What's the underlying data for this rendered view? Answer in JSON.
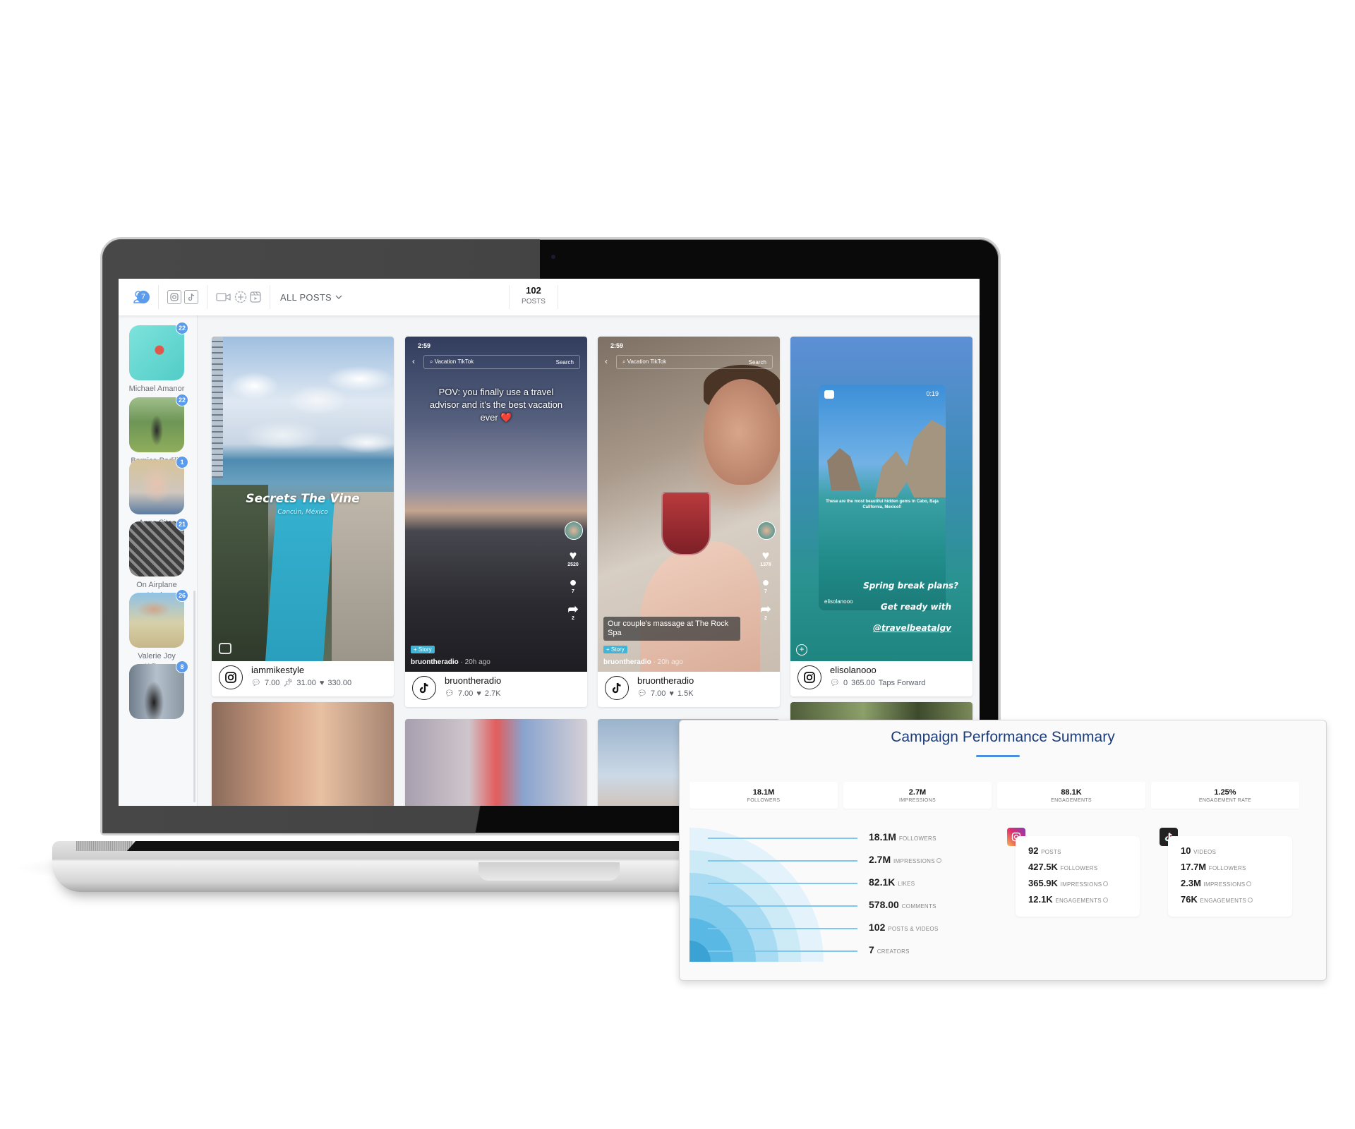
{
  "app": {
    "header": {
      "creators_count": "7",
      "filter_label": "ALL POSTS",
      "posts_count": "102",
      "posts_label": "POSTS",
      "icons": [
        "creators-icon",
        "instagram-filter-icon",
        "tiktok-filter-icon",
        "video-icon",
        "add-icon",
        "reel-icon",
        "chevron-down-icon"
      ]
    },
    "sidebar": {
      "creators": [
        {
          "name": "Michael Amanor",
          "count": "22"
        },
        {
          "name": "Bernice Padilla",
          "count": "22"
        },
        {
          "name": "Anna Sitar",
          "count": "1"
        },
        {
          "name": "On Airplane Mode",
          "count": "21"
        },
        {
          "name": "Valerie Joy Wilson",
          "count": "26"
        },
        {
          "name": "",
          "count": "8"
        }
      ]
    },
    "posts": [
      {
        "platform": "instagram",
        "handle": "iammikestyle",
        "overlay_title": "Secrets The Vine",
        "overlay_subtitle": "Cancún, México",
        "stats": {
          "comments": "7.00",
          "saves": "31.00",
          "likes": "330.00"
        }
      },
      {
        "platform": "tiktok",
        "handle": "bruontheradio",
        "status_time": "2:59",
        "search_text": "Vacation TikTok",
        "search_button": "Search",
        "caption": "POV: you finally use a travel advisor and it's the best vacation ever ❤️",
        "side": {
          "likes": "2520",
          "comments": "7",
          "shares": "2"
        },
        "story_chip": "+ Story",
        "author": "bruontheradio",
        "ago": "· 20h ago",
        "stats": {
          "comments": "7.00",
          "likes": "2.7K"
        }
      },
      {
        "platform": "tiktok",
        "handle": "bruontheradio",
        "status_time": "2:59",
        "search_text": "Vacation TikTok",
        "search_button": "Search",
        "comment_box": "Our couple's massage at The Rock Spa",
        "side": {
          "likes": "1378",
          "comments": "7",
          "shares": "2"
        },
        "story_chip": "+ Story",
        "author": "bruontheradio",
        "ago": "· 20h ago",
        "stats": {
          "comments": "7.00",
          "likes": "1.5K"
        }
      },
      {
        "platform": "instagram",
        "handle": "elisolanooo",
        "reel_duration": "0:19",
        "reel_caption": "These are the most beautiful hidden gems in Cabo, Baja California, Mexico!!",
        "reel_author": "elisolanooo",
        "overlay_lines": [
          "Spring break plans?",
          "Get ready with",
          "@travelbeatalgv"
        ],
        "stats": {
          "comments": "0",
          "taps_forward": "365.00",
          "taps_forward_label": "Taps Forward"
        }
      }
    ]
  },
  "summary": {
    "title": "Campaign Performance Summary",
    "kpis": [
      {
        "value": "18.1M",
        "label": "FOLLOWERS"
      },
      {
        "value": "2.7M",
        "label": "IMPRESSIONS"
      },
      {
        "value": "88.1K",
        "label": "ENGAGEMENTS"
      },
      {
        "value": "1.25%",
        "label": "ENGAGEMENT RATE"
      }
    ],
    "funnel": [
      {
        "value": "18.1M",
        "label": "FOLLOWERS"
      },
      {
        "value": "2.7M",
        "label": "IMPRESSIONS",
        "info": true
      },
      {
        "value": "82.1K",
        "label": "LIKES"
      },
      {
        "value": "578.00",
        "label": "COMMENTS"
      },
      {
        "value": "102",
        "label": "POSTS & VIDEOS"
      },
      {
        "value": "7",
        "label": "CREATORS"
      }
    ],
    "instagram": {
      "rows": [
        {
          "value": "92",
          "label": "POSTS"
        },
        {
          "value": "427.5K",
          "label": "FOLLOWERS"
        },
        {
          "value": "365.9K",
          "label": "IMPRESSIONS"
        },
        {
          "value": "12.1K",
          "label": "ENGAGEMENTS"
        }
      ]
    },
    "tiktok": {
      "rows": [
        {
          "value": "10",
          "label": "VIDEOS"
        },
        {
          "value": "17.7M",
          "label": "FOLLOWERS"
        },
        {
          "value": "2.3M",
          "label": "IMPRESSIONS"
        },
        {
          "value": "76K",
          "label": "ENGAGEMENTS"
        }
      ]
    },
    "colors": {
      "title": "#1b3c7a",
      "accent": "#4a90e2",
      "funnel_base": "#4fb6e3"
    }
  }
}
